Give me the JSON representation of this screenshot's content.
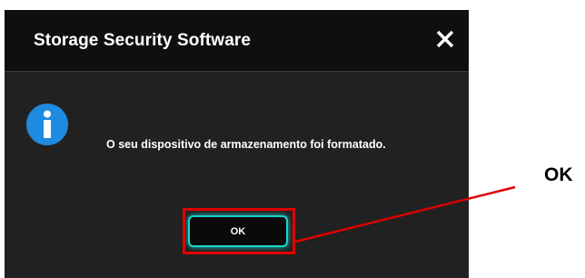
{
  "dialog": {
    "title": "Storage Security Software",
    "message": "O seu dispositivo de armazenamento foi formatado.",
    "ok_label": "OK",
    "close_icon": "close-icon",
    "info_icon": "info-icon"
  },
  "annotation": {
    "label": "OK",
    "highlight_color": "#e00000"
  },
  "colors": {
    "dialog_background": "#212121",
    "titlebar_background": "#0f0f0f",
    "accent": "#19d4cc",
    "info_blue": "#1f8be0"
  }
}
